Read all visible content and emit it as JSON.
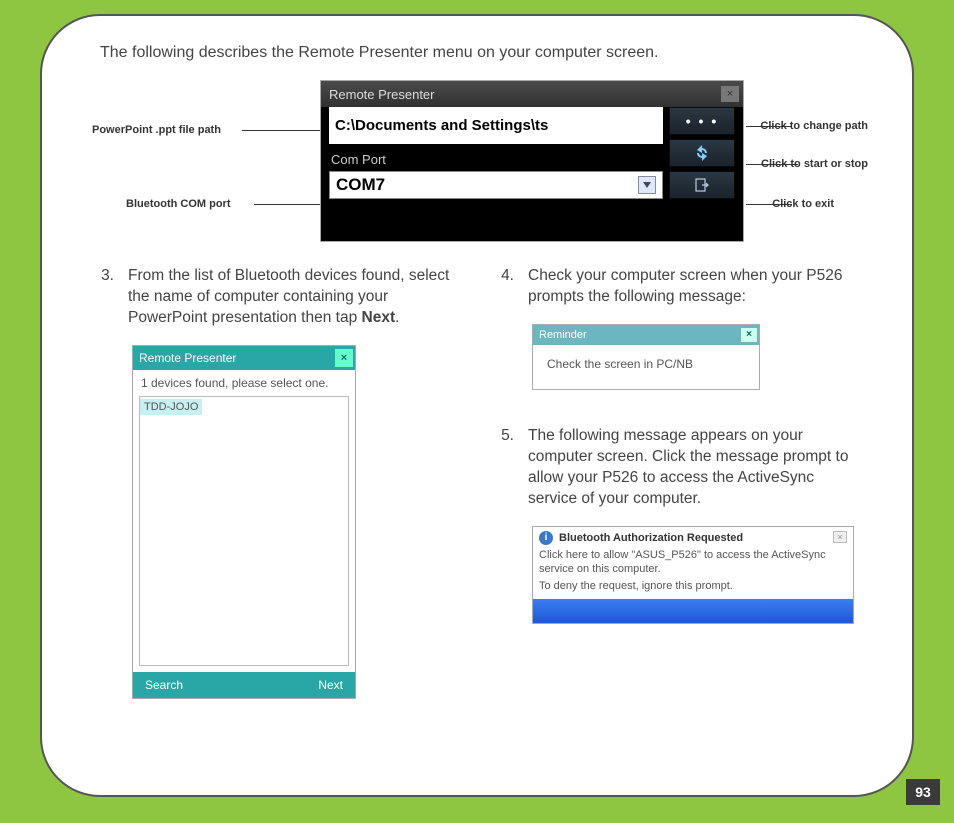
{
  "intro": "The following describes the Remote Presenter menu on your computer screen.",
  "remote_presenter": {
    "title": "Remote Presenter",
    "path_value": "C:\\Documents and Settings\\ts",
    "com_label": "Com Port",
    "com_value": "COM7"
  },
  "callouts": {
    "left1": "PowerPoint .ppt file path",
    "left2": "Bluetooth COM port",
    "right1": "Click to change path",
    "right2": "Click to start or stop",
    "right3": "Click to exit"
  },
  "steps": {
    "s3_num": "3.",
    "s3_text_a": "From the list of Bluetooth devices found, select the name of computer containing your PowerPoint presentation then tap ",
    "s3_text_b": "Next",
    "s3_text_c": ".",
    "s4_num": "4.",
    "s4_text": "Check your computer screen when your P526 prompts the following message:",
    "s5_num": "5.",
    "s5_text": "The following message appears on your computer screen. Click the message prompt to allow your P526 to access the ActiveSync service of your computer."
  },
  "device": {
    "title": "Remote Presenter",
    "msg": "1 devices found, please select one.",
    "selected": "TDD-JOJO",
    "btn_left": "Search",
    "btn_right": "Next"
  },
  "reminder": {
    "title": "Reminder",
    "body": "Check the screen in PC/NB"
  },
  "balloon": {
    "title": "Bluetooth Authorization Requested",
    "line1": "Click here to allow \"ASUS_P526\" to access the ActiveSync service on this computer.",
    "line2": "To deny the request, ignore this prompt."
  },
  "page_number": "93"
}
